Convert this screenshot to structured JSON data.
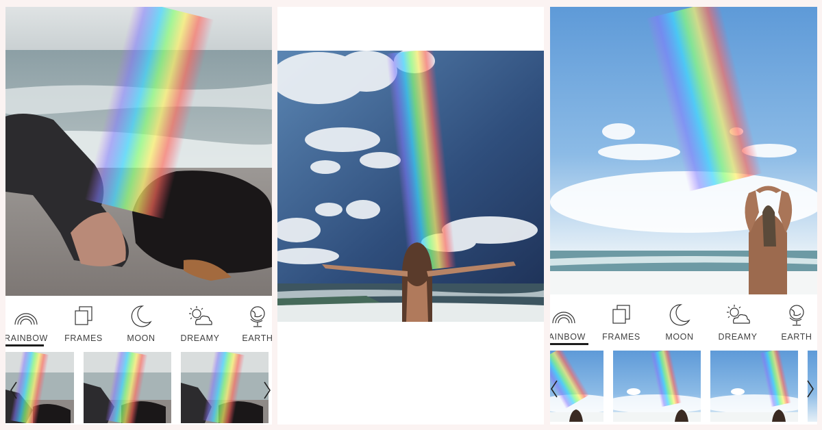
{
  "screens": {
    "left": {
      "tools": [
        {
          "label": "RAINBOW",
          "icon": "rainbow-icon",
          "selected": true
        },
        {
          "label": "FRAMES",
          "icon": "frames-icon"
        },
        {
          "label": "MOON",
          "icon": "moon-icon"
        },
        {
          "label": "DREAMY",
          "icon": "dreamy-icon"
        },
        {
          "label": "EARTH",
          "icon": "globe-icon"
        }
      ]
    },
    "right": {
      "tools": [
        {
          "label": "RAINBOW",
          "icon": "rainbow-icon",
          "selected": true
        },
        {
          "label": "FRAMES",
          "icon": "frames-icon"
        },
        {
          "label": "MOON",
          "icon": "moon-icon"
        },
        {
          "label": "DREAMY",
          "icon": "dreamy-icon"
        },
        {
          "label": "EARTH",
          "icon": "globe-icon"
        }
      ]
    }
  },
  "colors": {
    "background": "#fbf3f2",
    "label_text": "#3f3f3f",
    "selected_underline": "#1c1c1c"
  }
}
